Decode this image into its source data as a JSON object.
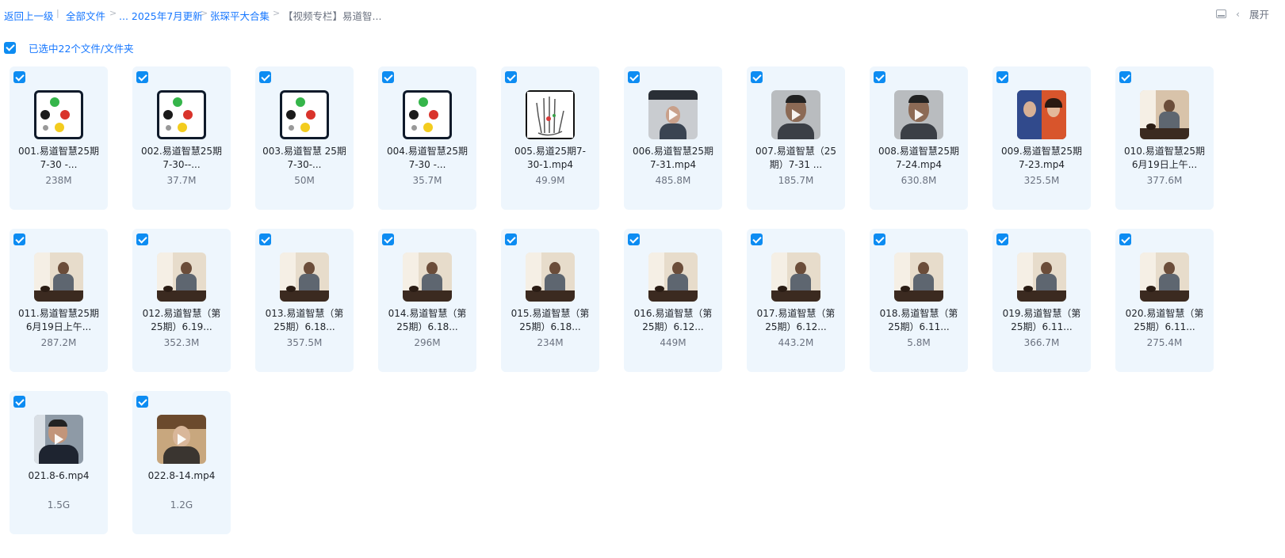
{
  "breadcrumb": {
    "back": "返回上一级",
    "all_files": "全部文件",
    "ellipsis_path": "... 2025年7月更新",
    "folder": "张琛平大合集",
    "current": "【视频专栏】易道智..."
  },
  "toolbar": {
    "expand": "展开"
  },
  "selection": {
    "text": "已选中22个文件/文件夹"
  },
  "files": [
    {
      "name": "001.易道智慧25期7-30 -...",
      "size": "238M",
      "thumb": "dots"
    },
    {
      "name": "002.易道智慧25期7-30--...",
      "size": "37.7M",
      "thumb": "dots"
    },
    {
      "name": "003.易道智慧 25期7-30-...",
      "size": "50M",
      "thumb": "dots"
    },
    {
      "name": "004.易道智慧25期7-30 -...",
      "size": "35.7M",
      "thumb": "dots"
    },
    {
      "name": "005.易道25期7-30-1.mp4",
      "size": "49.9M",
      "thumb": "palm"
    },
    {
      "name": "006.易道智慧25期7-31.mp4",
      "size": "485.8M",
      "thumb": "meet"
    },
    {
      "name": "007.易道智慧（25期）7-31 ...",
      "size": "185.7M",
      "thumb": "face"
    },
    {
      "name": "008.易道智慧25期7-24.mp4",
      "size": "630.8M",
      "thumb": "face"
    },
    {
      "name": "009.易道智慧25期7-23.mp4",
      "size": "325.5M",
      "thumb": "pair"
    },
    {
      "name": "010.易道智慧25期6月19日上午...",
      "size": "377.6M",
      "thumb": "room"
    },
    {
      "name": "011.易道智慧25期6月19日上午...",
      "size": "287.2M",
      "thumb": "table"
    },
    {
      "name": "012.易道智慧（第25期）6.19...",
      "size": "352.3M",
      "thumb": "table"
    },
    {
      "name": "013.易道智慧（第25期）6.18...",
      "size": "357.5M",
      "thumb": "table"
    },
    {
      "name": "014.易道智慧（第25期）6.18...",
      "size": "296M",
      "thumb": "table"
    },
    {
      "name": "015.易道智慧（第25期）6.18...",
      "size": "234M",
      "thumb": "table"
    },
    {
      "name": "016.易道智慧（第25期）6.12...",
      "size": "449M",
      "thumb": "table"
    },
    {
      "name": "017.易道智慧（第25期）6.12...",
      "size": "443.2M",
      "thumb": "table"
    },
    {
      "name": "018.易道智慧（第25期）6.11...",
      "size": "5.8M",
      "thumb": "table"
    },
    {
      "name": "019.易道智慧（第25期）6.11...",
      "size": "366.7M",
      "thumb": "table"
    },
    {
      "name": "020.易道智慧（第25期）6.11...",
      "size": "275.4M",
      "thumb": "table"
    },
    {
      "name": "021.8-6.mp4",
      "size": "1.5G",
      "thumb": "indoor"
    },
    {
      "name": "022.8-14.mp4",
      "size": "1.2G",
      "thumb": "warm"
    }
  ],
  "colors": {
    "accent": "#0d8cf2",
    "link": "#1677ff",
    "card_bg": "#eef6fd"
  }
}
